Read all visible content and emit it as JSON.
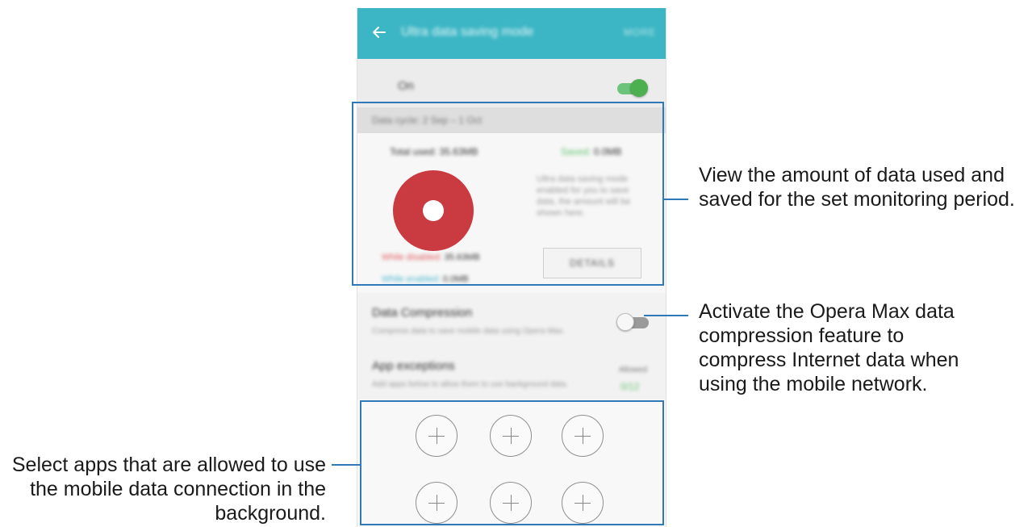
{
  "screen": {
    "appbar": {
      "back_icon": "arrow-left-icon",
      "title": "Ultra data saving mode",
      "action": "MORE"
    },
    "master_toggle": {
      "label": "On",
      "state": "on"
    },
    "usage": {
      "period": "Data cycle: 2 Sep – 1 Oct",
      "total_label": "Total used:",
      "total_value": "35.63MB",
      "saved_label": "Saved:",
      "saved_value": "0.0MB",
      "description": "Ultra data saving mode enabled for you to save data, the amount will be shown here.",
      "legend": [
        {
          "label": "While disabled:",
          "value": "35.63MB",
          "color": "#e05a5d"
        },
        {
          "label": "While enabled:",
          "value": "0.0MB",
          "color": "#4ab8d0"
        }
      ],
      "details_button": "DETAILS",
      "donut_color": "#c93b40"
    },
    "compression": {
      "title": "Data Compression",
      "subtitle": "Compress data to save mobile data using Opera Max.",
      "state": "off"
    },
    "exceptions": {
      "title": "App exceptions",
      "subtitle": "Add apps below to allow them to use background data.",
      "allowed_label": "Allowed",
      "allowed_value": "0/12"
    },
    "add_app_buttons": 6
  },
  "callouts": {
    "usage": "View the amount of data used and saved for the set monitoring period.",
    "compression": "Activate the Opera Max data compression feature to compress Internet data when using the mobile network.",
    "apps": "Select apps that are allowed to use the mobile data connection in the background."
  },
  "colors": {
    "accent_bar": "#3cb6c4",
    "highlight": "#2f79b9",
    "toggle_on": "#4caf50"
  }
}
